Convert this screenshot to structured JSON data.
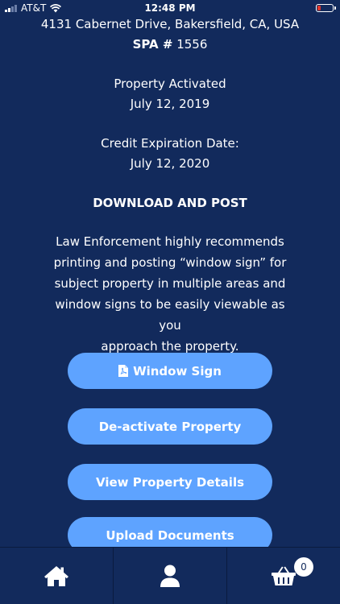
{
  "status_bar": {
    "carrier": "AT&T",
    "time": "12:48 PM"
  },
  "property": {
    "address": "4131 Cabernet Drive, Bakersfield, CA, USA",
    "spa_label": "SPA #",
    "spa_number": "1556",
    "activated_label": "Property Activated",
    "activated_date": "July 12, 2019",
    "expiry_label": "Credit Expiration Date:",
    "expiry_date": "July 12, 2020"
  },
  "download": {
    "heading": "DOWNLOAD AND POST",
    "lines": [
      "Law Enforcement highly recommends",
      "printing and posting “window sign” for",
      "subject property in multiple areas and",
      "window signs to be easily viewable as you",
      "approach the property."
    ]
  },
  "buttons": {
    "window_sign": "Window Sign",
    "deactivate": "De-activate Property",
    "details": "View Property Details",
    "upload": "Upload Documents"
  },
  "tab_bar": {
    "cart_count": "0"
  },
  "icons": {
    "home": "home-icon",
    "profile": "user-icon",
    "cart": "basket-icon",
    "pdf": "pdf-file-icon"
  },
  "colors": {
    "background": "#122a5c",
    "button": "#5ea3ff",
    "battery_low": "#e0352b"
  }
}
